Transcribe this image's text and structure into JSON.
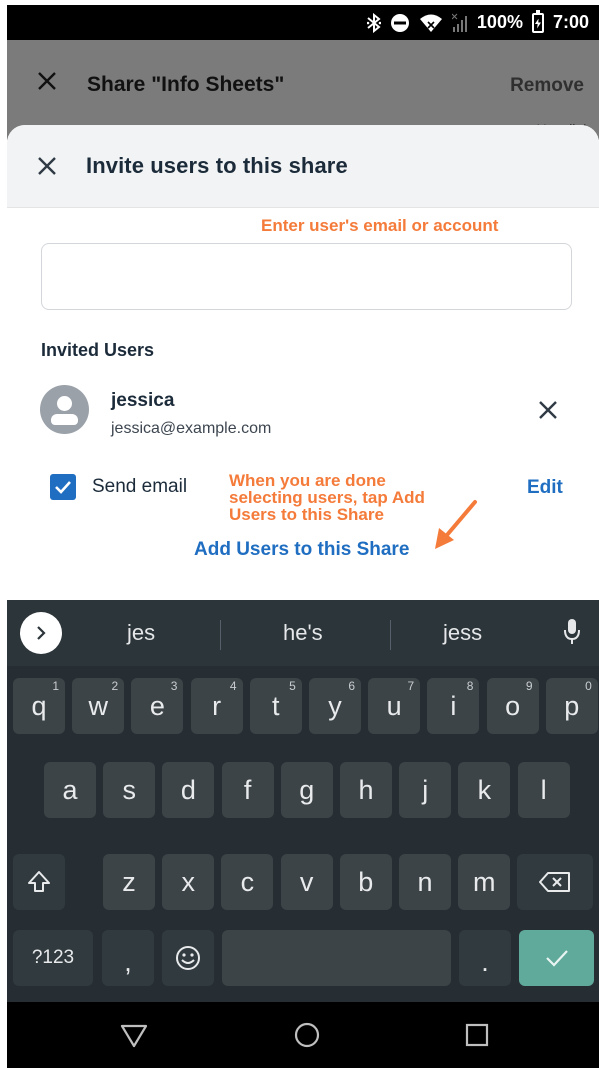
{
  "status_bar": {
    "battery": "100%",
    "time": "7:00",
    "icons": [
      "bluetooth-icon",
      "do-not-disturb-icon",
      "wifi-icon",
      "no-signal-icon",
      "battery-charging-icon"
    ]
  },
  "background_sheet": {
    "title": "Share \"Info Sheets\"",
    "remove_label": "Remove",
    "peek_text": "Uncollab"
  },
  "modal": {
    "title": "Invite users to this share",
    "email_input": {
      "value": "",
      "placeholder": ""
    },
    "invited_users_label": "Invited Users",
    "users": [
      {
        "name": "jessica",
        "email": "jessica@example.com"
      }
    ],
    "send_email": {
      "label": "Send email",
      "checked": true
    },
    "edit_label": "Edit",
    "add_users_label": "Add Users to this Share"
  },
  "annotations": {
    "email_hint": "Enter user's email or account",
    "done_hint": "When you are done selecting users, tap Add Users to this Share"
  },
  "keyboard": {
    "suggestions": [
      "jes",
      "he's",
      "jess"
    ],
    "row1": [
      {
        "k": "q",
        "n": "1"
      },
      {
        "k": "w",
        "n": "2"
      },
      {
        "k": "e",
        "n": "3"
      },
      {
        "k": "r",
        "n": "4"
      },
      {
        "k": "t",
        "n": "5"
      },
      {
        "k": "y",
        "n": "6"
      },
      {
        "k": "u",
        "n": "7"
      },
      {
        "k": "i",
        "n": "8"
      },
      {
        "k": "o",
        "n": "9"
      },
      {
        "k": "p",
        "n": "0"
      }
    ],
    "row2": [
      "a",
      "s",
      "d",
      "f",
      "g",
      "h",
      "j",
      "k",
      "l"
    ],
    "row3": [
      "z",
      "x",
      "c",
      "v",
      "b",
      "n",
      "m"
    ],
    "symbols_label": "?123",
    "comma": ",",
    "period": "."
  },
  "colors": {
    "accent": "#1f6ec1",
    "annotation": "#f47b3a",
    "enter_key": "#5faa9b"
  }
}
